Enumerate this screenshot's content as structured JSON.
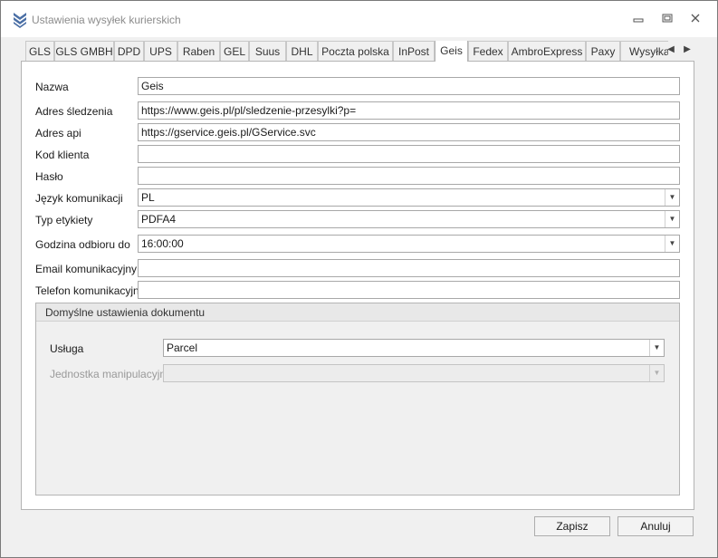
{
  "window": {
    "title": "Ustawienia wysyłek kurierskich",
    "minimize_icon": "minimize-icon",
    "restore_icon": "restore-icon",
    "close_icon": "close-icon"
  },
  "tabs": [
    {
      "label": "GLS"
    },
    {
      "label": "GLS GMBH"
    },
    {
      "label": "DPD"
    },
    {
      "label": "UPS"
    },
    {
      "label": "Raben"
    },
    {
      "label": "GEL"
    },
    {
      "label": "Suus"
    },
    {
      "label": "DHL"
    },
    {
      "label": "Poczta polska"
    },
    {
      "label": "InPost"
    },
    {
      "label": "Geis"
    },
    {
      "label": "Fedex"
    },
    {
      "label": "AmbroExpress"
    },
    {
      "label": "Paxy"
    },
    {
      "label": "Wysyłka"
    }
  ],
  "active_tab": "Geis",
  "form": {
    "nazwa": {
      "label": "Nazwa",
      "value": "Geis"
    },
    "adres_sledzenia": {
      "label": "Adres śledzenia",
      "value": "https://www.geis.pl/pl/sledzenie-przesylki?p="
    },
    "adres_api": {
      "label": "Adres api",
      "value": "https://gservice.geis.pl/GService.svc"
    },
    "kod_klienta": {
      "label": "Kod klienta",
      "value": ""
    },
    "haslo": {
      "label": "Hasło",
      "value": ""
    },
    "jezyk": {
      "label": "Język komunikacji",
      "value": "PL"
    },
    "typ_etykiety": {
      "label": "Typ etykiety",
      "value": "PDFA4"
    },
    "godzina_odbioru": {
      "label": "Godzina odbioru do",
      "value": "16:00:00"
    },
    "email": {
      "label": "Email komunikacyjny",
      "value": ""
    },
    "telefon": {
      "label": "Telefon komunikacyjny",
      "value": ""
    }
  },
  "group": {
    "title": "Domyślne ustawienia dokumentu",
    "usluga": {
      "label": "Usługa",
      "value": "Parcel"
    },
    "jednostka": {
      "label": "Jednostka manipulacyjna",
      "value": ""
    }
  },
  "buttons": {
    "save": "Zapisz",
    "cancel": "Anuluj"
  },
  "glyphs": {
    "minimize": "▭",
    "restore": "⧉",
    "close": "✕",
    "scroll_left": "◀",
    "scroll_right": "▶",
    "dropdown": "▼"
  },
  "colors": {
    "window_bg": "#f0f0f0",
    "panel_bg": "#ffffff",
    "border": "#b4b4b4",
    "app_icon": "#4a6fa5"
  }
}
